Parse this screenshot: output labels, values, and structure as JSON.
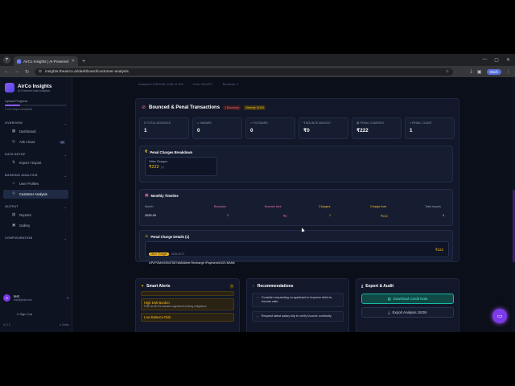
{
  "browser": {
    "tab_title": "AirCo Insights | AI-Powered De...",
    "url": "insights.theairco.ai/dashboard/customer-analysis",
    "work_label": "Work"
  },
  "sidebar": {
    "brand_name": "AirCo Insights",
    "brand_sub": "AI-Powered Data Analytics",
    "upload_progress_label": "Upload Progress",
    "upload_progress_fraction": 0.25,
    "upload_progress_text": "1 of 4 steps completed",
    "sections": {
      "overview": "OVERVIEW",
      "data_setup": "DATA SETUP",
      "banking_analysis": "BANKING ANALYSIS",
      "output": "OUTPUT",
      "configuration": "CONFIGURATION"
    },
    "items": {
      "dashboard": "Dashboard",
      "ask_airvaz": "Ask Airvaz",
      "ask_badge": "AI",
      "import_export": "Import / Export",
      "user_profiles": "User Profiles",
      "customer_analysis": "Customer Analysis",
      "reports": "Reports",
      "gallery": "Gallery"
    },
    "user_initial": "A",
    "user_name": "test",
    "user_email": "test@gmail.com",
    "sign_out": "Sign Out",
    "version": "v2.1.0",
    "status": "Online"
  },
  "breadcrumb": {
    "c1": "Analyzed 2/3/2026, 8:06:11 PM",
    "c2": "Cust: RAJAT7",
    "c3": "Bounces: 1"
  },
  "bounce": {
    "title": "Bounced & Penal Transactions",
    "bounces_pill": "1 Bounce(s)",
    "severity_pill": "Severity: 5/100",
    "stats": [
      {
        "label": "TOTAL BOUNCES",
        "value": "1"
      },
      {
        "label": "INWARD",
        "value": "0"
      },
      {
        "label": "OUTWARD",
        "value": "0"
      },
      {
        "label": "BOUNCE AMOUNT",
        "value": "₹0"
      },
      {
        "label": "PENAL CHARGES",
        "value": "₹222"
      },
      {
        "label": "PENAL COUNT",
        "value": "1"
      }
    ],
    "breakdown_title": "Penal Charges Breakdown",
    "breakdown_item_label": "Other Charges",
    "breakdown_item_value": "₹222",
    "breakdown_item_count": "(1)",
    "timeline_title": "Monthly Timeline",
    "timeline_headers": {
      "month": "Month",
      "bounces": "Bounces",
      "bounce_amt": "Bounce Amt",
      "charges": "Charges",
      "charge_amt": "Charge Amt",
      "total_issues": "Total Issues"
    },
    "timeline_row": {
      "month": "2025-09",
      "bounces": "0",
      "bounce_amt": "₹0",
      "charges": "1",
      "charge_amt": "₹222",
      "total_issues": "1"
    },
    "details_title": "Penal Charge Details (1)",
    "detail_tag": "Other Charges",
    "detail_date": "2025-09-27",
    "detail_desc": "UPI/P2M/493947557488/Airtel Recharge /Payment/AXIS BANK",
    "detail_amount": "₹222"
  },
  "smart_alerts": {
    "title": "Smart Alerts",
    "count": "3",
    "alerts": [
      {
        "title": "High EMI Burden",
        "desc": "FOIR at 89.2% indicates significant existing obligations"
      },
      {
        "title": "Low Balance Risk",
        "desc": ""
      }
    ]
  },
  "recommendations": {
    "title": "Recommendations",
    "items": [
      "Consider requesting co-applicant to improve debt-to-income ratio",
      "Request latest salary slip to verify income continuity"
    ]
  },
  "export": {
    "title": "Export & Audit",
    "download_label": "Download Credit Note",
    "json_label": "Export Analysis JSON"
  }
}
